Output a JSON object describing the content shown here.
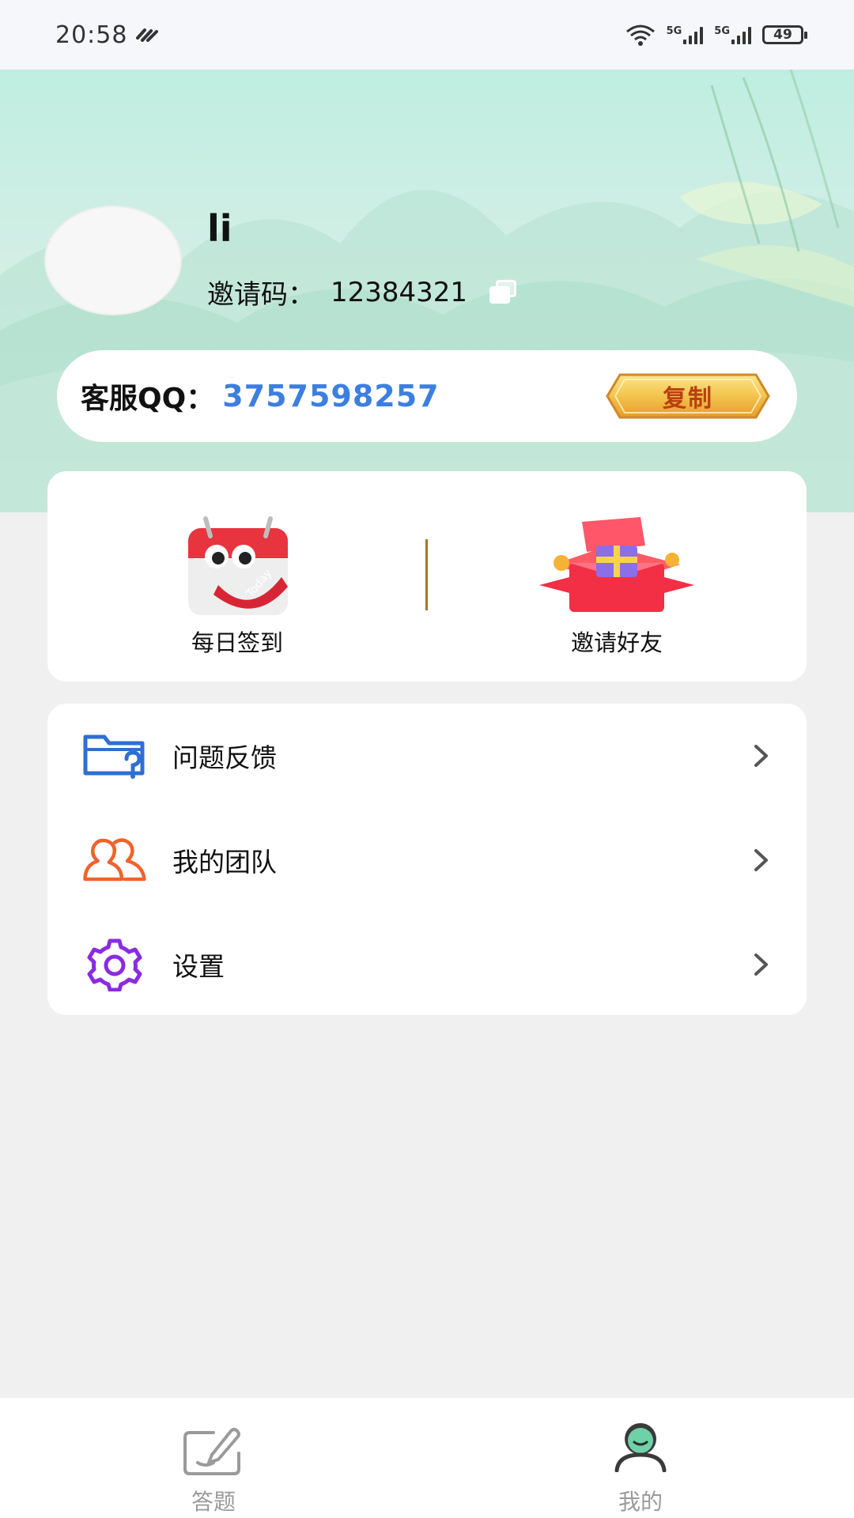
{
  "status_bar": {
    "time": "20:58",
    "network_1": "5G",
    "network_2": "5G",
    "battery": "49"
  },
  "profile": {
    "username": "li",
    "invite_label": "邀请码：",
    "invite_code": "12384321"
  },
  "support": {
    "label": "客服QQ：",
    "qq_number": "3757598257",
    "copy_label": "复制"
  },
  "quick_actions": [
    {
      "label": "每日签到",
      "icon": "calendar-today-icon"
    },
    {
      "label": "邀请好友",
      "icon": "gift-box-icon"
    }
  ],
  "menu": [
    {
      "label": "问题反馈",
      "icon": "folder-question-icon",
      "color": "#2f6fcf"
    },
    {
      "label": "我的团队",
      "icon": "team-users-icon",
      "color": "#f0622d"
    },
    {
      "label": "设置",
      "icon": "settings-gear-icon",
      "color": "#8a2be2"
    }
  ],
  "tabs": [
    {
      "label": "答题",
      "icon": "edit-quiz-icon",
      "active": false
    },
    {
      "label": "我的",
      "icon": "profile-avatar-icon",
      "active": true
    }
  ],
  "colors": {
    "accent_blue": "#3d7fe0",
    "copy_button_gold": "#f3c34d",
    "copy_text": "#b8400f"
  }
}
